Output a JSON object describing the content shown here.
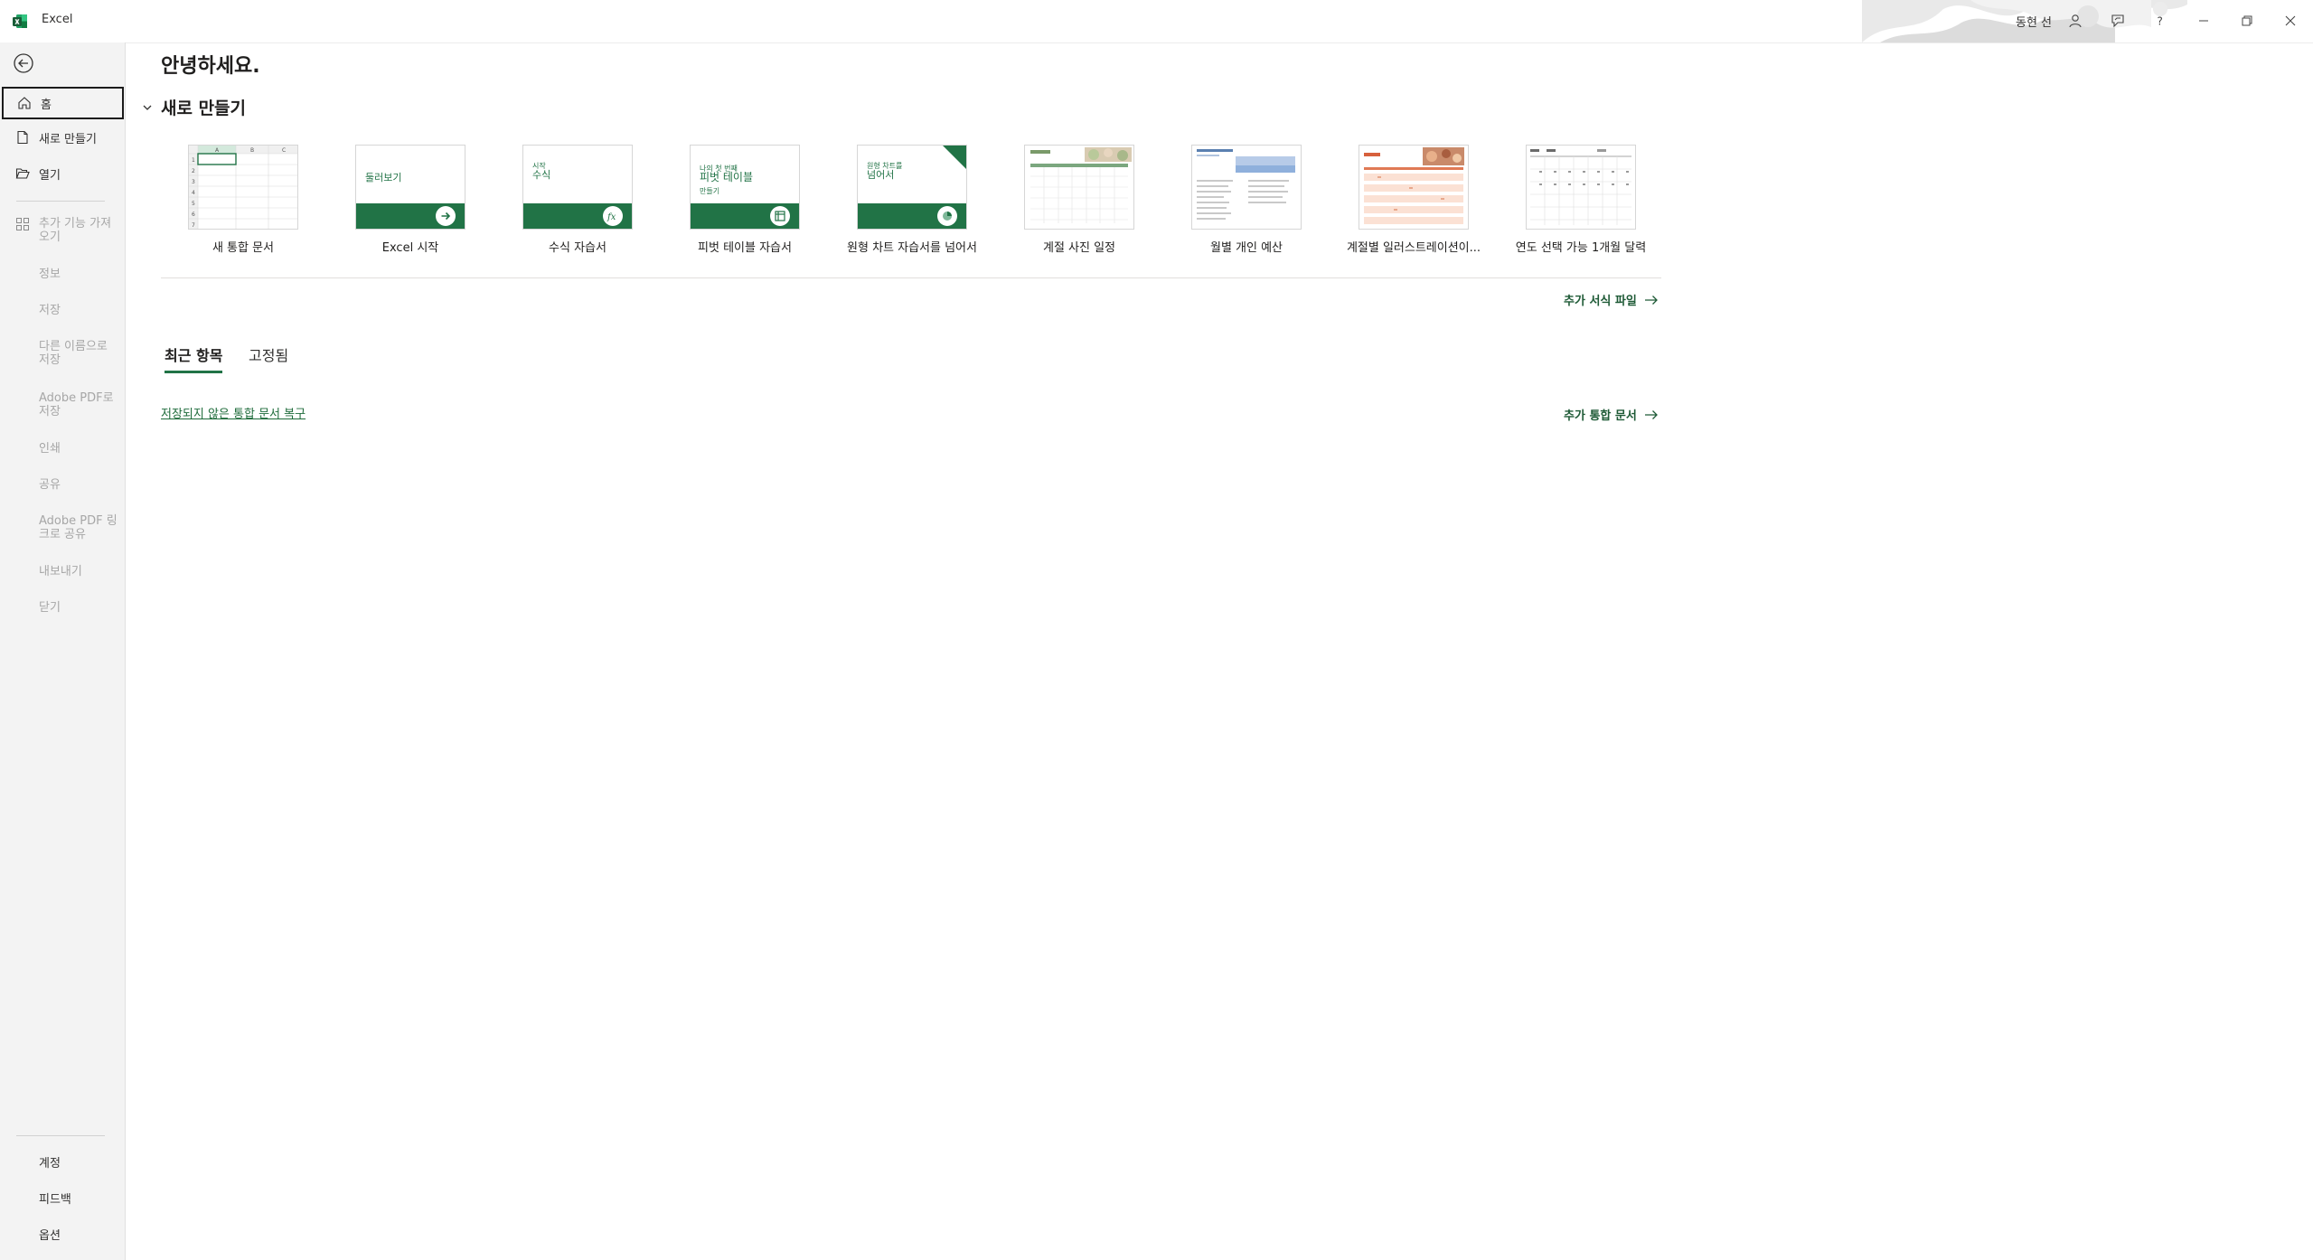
{
  "titlebar": {
    "app_name": "Excel",
    "user_name": "동현 선"
  },
  "sidebar": {
    "nav": [
      {
        "label": "홈",
        "icon": "home-icon"
      },
      {
        "label": "새로 만들기",
        "icon": "new-document-icon"
      },
      {
        "label": "열기",
        "icon": "open-folder-icon"
      }
    ],
    "addins_label": "추가 기능 가져오기",
    "disabled_items": [
      "정보",
      "저장",
      "다른 이름으로 저장",
      "Adobe PDF로 저장",
      "인쇄",
      "공유",
      "Adobe PDF 링크로 공유",
      "내보내기",
      "닫기"
    ],
    "bottom_items": [
      "계정",
      "피드백",
      "옵션"
    ]
  },
  "main": {
    "greeting": "안녕하세요.",
    "new_heading": "새로 만들기",
    "templates": [
      {
        "label": "새 통합 문서"
      },
      {
        "label": "Excel 시작",
        "thumb_text": "둘러보기"
      },
      {
        "label": "수식 자습서",
        "thumb_text_top": "시작",
        "thumb_text": "수식"
      },
      {
        "label": "피벗 테이블 자습서",
        "thumb_text_top": "나의 첫 번째",
        "thumb_text": "피벗 테이블",
        "thumb_text_bottom": "만들기"
      },
      {
        "label": "원형 차트 자습서를 넘어서",
        "thumb_text_top": "원형 차트를",
        "thumb_text": "넘어서"
      },
      {
        "label": "계절 사진 일정"
      },
      {
        "label": "월별 개인 예산"
      },
      {
        "label": "계절별 일러스트레이션이..."
      },
      {
        "label": "연도 선택 가능 1개월 달력"
      }
    ],
    "more_templates": "추가 서식 파일",
    "tabs": [
      {
        "label": "최근 항목",
        "active": true
      },
      {
        "label": "고정됨",
        "active": false
      }
    ],
    "recover_link": "저장되지 않은 통합 문서 복구",
    "more_workbooks": "추가 통합 문서"
  },
  "colors": {
    "accent": "#217346",
    "link": "#1e6b3a",
    "sidebar_bg": "#f3f3f3"
  }
}
